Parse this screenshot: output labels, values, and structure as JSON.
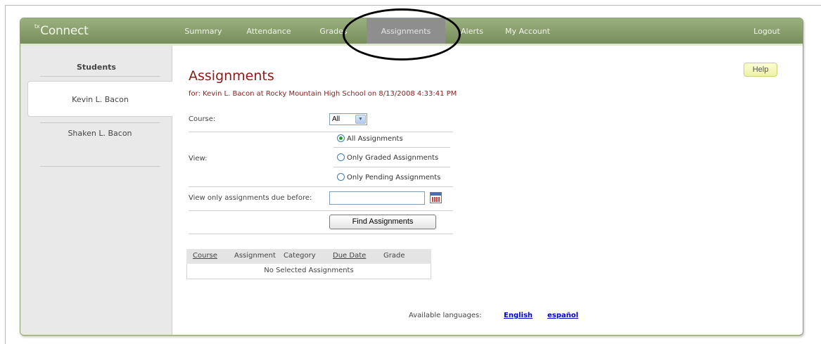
{
  "app": {
    "logo_prefix": "tx",
    "logo_text": "Connect"
  },
  "nav": {
    "items": [
      {
        "label": "Summary"
      },
      {
        "label": "Attendance"
      },
      {
        "label": "Grades"
      },
      {
        "label": "Assignments",
        "active": true
      },
      {
        "label": "Alerts"
      },
      {
        "label": "My Account"
      }
    ],
    "logout": "Logout"
  },
  "sidebar": {
    "title": "Students",
    "students": [
      {
        "name": "Kevin L. Bacon",
        "selected": true
      },
      {
        "name": "Shaken L. Bacon",
        "selected": false
      }
    ]
  },
  "page": {
    "title": "Assignments",
    "subtitle": "for: Kevin L. Bacon at Rocky Mountain High School on 8/13/2008 4:33:41 PM",
    "help_label": "Help"
  },
  "form": {
    "course_label": "Course:",
    "course_value": "All",
    "view_label": "View:",
    "view_options": [
      {
        "label": "All Assignments",
        "checked": true
      },
      {
        "label": "Only Graded Assignments",
        "checked": false
      },
      {
        "label": "Only Pending Assignments",
        "checked": false
      }
    ],
    "due_before_label": "View only assignments due before:",
    "due_before_value": "",
    "find_button": "Find Assignments"
  },
  "results": {
    "columns": [
      "Course",
      "Assignment",
      "Category",
      "Due Date",
      "Grade"
    ],
    "empty_message": "No Selected Assignments"
  },
  "languages": {
    "label": "Available languages:",
    "options": [
      "English",
      "español"
    ]
  },
  "colors": {
    "accent": "#8b1a1a",
    "nav_bg": "#8aa06e",
    "active_tab": "#8e8e8e"
  }
}
